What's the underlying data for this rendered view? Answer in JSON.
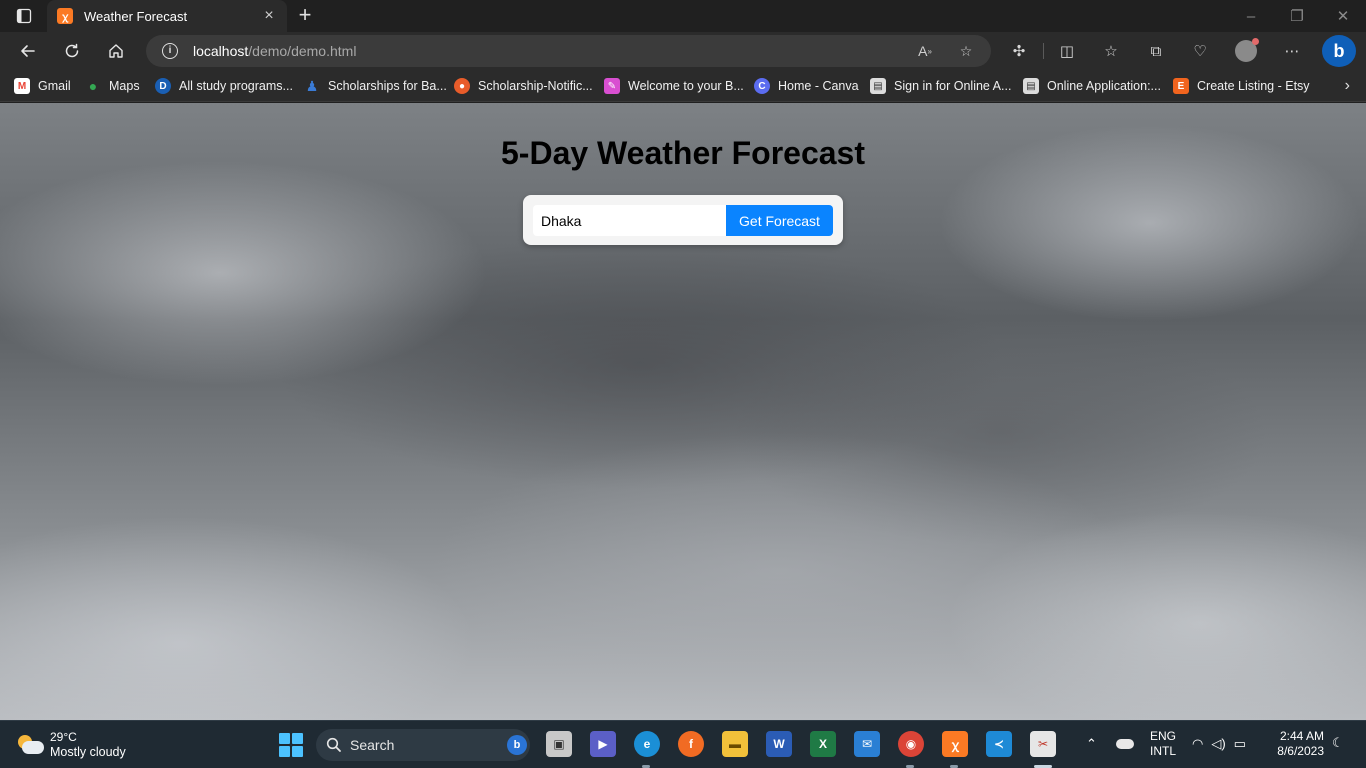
{
  "browser": {
    "tab_title": "Weather Forecast",
    "address_host": "localhost",
    "address_path": "/demo/demo.html",
    "bookmarks": [
      {
        "label": "Gmail",
        "icon": "gmail-icon",
        "color": "#ea4335",
        "glyph": "M"
      },
      {
        "label": "Maps",
        "icon": "maps-icon",
        "color": "#34a853",
        "glyph": "●"
      },
      {
        "label": "All study programs...",
        "icon": "daad-icon",
        "color": "#1a5fb4",
        "glyph": "D"
      },
      {
        "label": "Scholarships for Ba...",
        "icon": "scholarship-icon",
        "color": "#3a7bd5",
        "glyph": "♟"
      },
      {
        "label": "Scholarship-Notific...",
        "icon": "notification-icon",
        "color": "#e85c2a",
        "glyph": "●"
      },
      {
        "label": "Welcome to your B...",
        "icon": "welcome-icon",
        "color": "#d94fd1",
        "glyph": "✎"
      },
      {
        "label": "Home - Canva",
        "icon": "canva-icon",
        "color": "#5b6cf0",
        "glyph": "C"
      },
      {
        "label": "Sign in for Online A...",
        "icon": "signin-icon",
        "color": "#dcdcdc",
        "glyph": "▤"
      },
      {
        "label": "Online Application:...",
        "icon": "application-icon",
        "color": "#dcdcdc",
        "glyph": "▤"
      },
      {
        "label": "Create Listing - Etsy",
        "icon": "etsy-icon",
        "color": "#f1641e",
        "glyph": "E"
      }
    ]
  },
  "page": {
    "heading": "5-Day Weather Forecast",
    "city_value": "Dhaka",
    "button_label": "Get Forecast"
  },
  "taskbar": {
    "weather_temp": "29°C",
    "weather_desc": "Mostly cloudy",
    "search_label": "Search",
    "lang_line1": "ENG",
    "lang_line2": "INTL",
    "time": "2:44 AM",
    "date": "8/6/2023"
  }
}
